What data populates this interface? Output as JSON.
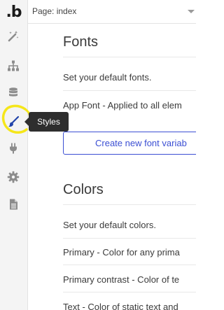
{
  "app": {
    "logo_text": ".b"
  },
  "topbar": {
    "page_selector": "Page: index"
  },
  "sidebar": {
    "items": [
      {
        "name": "design",
        "icon": "magic-wand-icon"
      },
      {
        "name": "workflow",
        "icon": "sitemap-icon"
      },
      {
        "name": "data",
        "icon": "database-icon"
      },
      {
        "name": "styles",
        "icon": "paintbrush-icon",
        "tooltip": "Styles"
      },
      {
        "name": "plugins",
        "icon": "plug-icon"
      },
      {
        "name": "settings",
        "icon": "gear-icon"
      },
      {
        "name": "logs",
        "icon": "document-icon"
      }
    ]
  },
  "fonts": {
    "title": "Fonts",
    "description": "Set your default fonts.",
    "app_font_label": "App Font - Applied to all elem",
    "create_button": "Create new font variab"
  },
  "colors": {
    "title": "Colors",
    "description": "Set your default colors.",
    "primary_label": "Primary - Color for any prima",
    "primary_contrast_label": "Primary contrast - Color of te",
    "text_label": "Text - Color of static text and"
  },
  "theme": {
    "accent": "#3b4fd3",
    "annotation": "#f5e61a",
    "tooltip_bg": "#2e2e2e",
    "icon_color": "#8c8c8c"
  }
}
